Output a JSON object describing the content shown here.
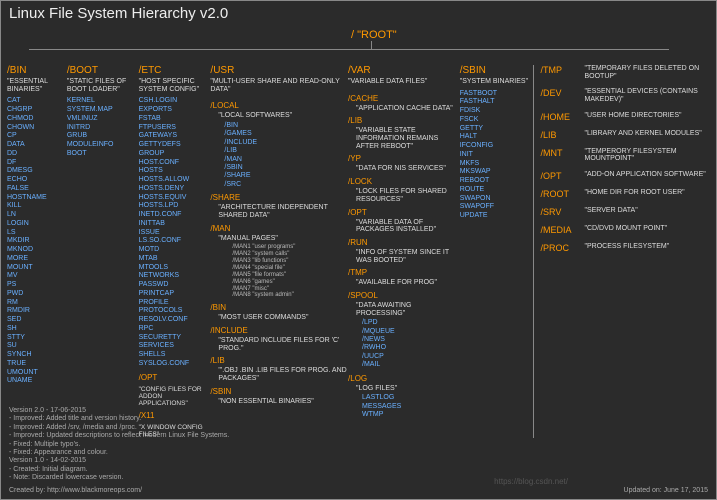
{
  "title": "Linux File System Hierarchy v2.0",
  "root": "/ \"ROOT\"",
  "cols": {
    "bin": {
      "head": "/BIN",
      "desc": "\"ESSENTIAL BINARIES\"",
      "items": [
        "CAT",
        "CHGRP",
        "CHMOD",
        "CHOWN",
        "CP",
        "DATA",
        "DD",
        "DF",
        "DMESG",
        "ECHO",
        "FALSE",
        "HOSTNAME",
        "KILL",
        "LN",
        "LOGIN",
        "LS",
        "MKDIR",
        "MKNOD",
        "MORE",
        "MOUNT",
        "MV",
        "PS",
        "PWD",
        "RM",
        "RMDIR",
        "SED",
        "SH",
        "STTY",
        "SU",
        "SYNCH",
        "TRUE",
        "UMOUNT",
        "UNAME"
      ]
    },
    "boot": {
      "head": "/BOOT",
      "desc": "\"STATIC FILES OF BOOT LOADER\"",
      "items": [
        "KERNEL",
        "SYSTEM.MAP",
        "VMLINUZ",
        "INITRD",
        "GRUB",
        "MODULEINFO",
        "BOOT"
      ]
    },
    "etc": {
      "head": "/ETC",
      "desc": "\"HOST SPECIFIC SYSTEM CONFIG\"",
      "items": [
        "CSH.LOGIN",
        "EXPORTS",
        "FSTAB",
        "FTPUSERS",
        "GATEWAYS",
        "GETTYDEFS",
        "GROUP",
        "HOST.CONF",
        "HOSTS",
        "HOSTS.ALLOW",
        "HOSTS.DENY",
        "HOSTS.EQUIV",
        "HOSTS.LPD",
        "INETD.CONF",
        "INITTAB",
        "ISSUE",
        "LS.SO.CONF",
        "MOTD",
        "MTAB",
        "MTOOLS",
        "NETWORKS",
        "PASSWD",
        "PRINTCAP",
        "PROFILE",
        "PROTOCOLS",
        "RESOLV.CONF",
        "RPC",
        "SECURETTY",
        "SERVICES",
        "SHELLS",
        "SYSLOG.CONF"
      ],
      "opt": {
        "head": "/OPT",
        "desc": "\"CONFIG FILES FOR ADDON APPLICATIONS\""
      },
      "x11": {
        "head": "/X11",
        "desc": "\"X WINDOW CONFIG FILES\""
      }
    },
    "usr": {
      "head": "/USR",
      "desc": "\"MULTI-USER SHARE AND READ-ONLY DATA\"",
      "subs": [
        {
          "head": "/LOCAL",
          "desc": "\"LOCAL SOFTWARES\"",
          "items": [
            "/BIN",
            "/GAMES",
            "/INCLUDE",
            "/LIB",
            "/MAN",
            "/SBIN",
            "/SHARE",
            "/SRC"
          ]
        },
        {
          "head": "/SHARE",
          "desc": "\"ARCHITECTURE INDEPENDENT SHARED DATA\""
        },
        {
          "head": "/MAN",
          "desc": "\"MANUAL PAGES\"",
          "subsubs": [
            "/MAN1 \"user programs\"",
            "/MAN2 \"system calls\"",
            "/MAN3 \"lib functions\"",
            "/MAN4 \"special file\"",
            "/MAN5 \"file formats\"",
            "/MAN6 \"games\"",
            "/MAN7 \"misc\"",
            "/MAN8 \"system admin\""
          ]
        },
        {
          "head": "/BIN",
          "desc": "\"MOST USER COMMANDS\""
        },
        {
          "head": "/INCLUDE",
          "desc": "\"STANDARD INCLUDE FILES FOR 'C' PROG.\""
        },
        {
          "head": "/LIB",
          "desc": "\"'.OBJ .BIN .LIB FILES FOR PROG. AND PACKAGES\""
        },
        {
          "head": "/SBIN",
          "desc": "\"NON ESSENTIAL BINARIES\""
        }
      ]
    },
    "var": {
      "head": "/VAR",
      "desc": "\"VARIABLE DATA FILES\"",
      "subs": [
        {
          "head": "/CACHE",
          "desc": "\"APPLICATION CACHE DATA\""
        },
        {
          "head": "/LIB",
          "desc": "\"VARIABLE STATE INFORMATION REMAINS AFTER REBOOT\""
        },
        {
          "head": "/YP",
          "desc": "\"DATA FOR NIS SERVICES\""
        },
        {
          "head": "/LOCK",
          "desc": "\"LOCK FILES FOR SHARED RESOURCES\""
        },
        {
          "head": "/OPT",
          "desc": "\"VARIABLE DATA OF PACKAGES INSTALLED\""
        },
        {
          "head": "/RUN",
          "desc": "\"INFO OF SYSTEM SINCE IT WAS BOOTED\""
        },
        {
          "head": "/TMP",
          "desc": "\"AVAILABLE FOR PROG\""
        },
        {
          "head": "/SPOOL",
          "desc": "\"DATA AWAITING PROCESSING\"",
          "items": [
            "/LPD",
            "/MQUEUE",
            "/NEWS",
            "/RWHO",
            "/UUCP",
            "/MAIL"
          ]
        },
        {
          "head": "/LOG",
          "desc": "\"LOG FILES\"",
          "items2": [
            "LASTLOG",
            "MESSAGES",
            "WTMP"
          ]
        }
      ]
    },
    "sbin": {
      "head": "/SBIN",
      "desc": "\"SYSTEM BINARIES\"",
      "items": [
        "FASTBOOT",
        "FASTHALT",
        "FDISK",
        "FSCK",
        "GETTY",
        "HALT",
        "IFCONFIG",
        "INIT",
        "MKFS",
        "MKSWAP",
        "REBOOT",
        "ROUTE",
        "SWAPON",
        "SWAPOFF",
        "UPDATE"
      ]
    }
  },
  "right": [
    {
      "head": "/TMP",
      "desc": "\"TEMPORARY FILES DELETED ON BOOTUP\""
    },
    {
      "head": "/DEV",
      "desc": "\"ESSENTIAL DEVICES (CONTAINS MAKEDEV)\""
    },
    {
      "head": "/HOME",
      "desc": "\"USER HOME DIRECTORIES\""
    },
    {
      "head": "/LIB",
      "desc": "\"LIBRARY AND KERNEL MODULES\""
    },
    {
      "head": "/MNT",
      "desc": "\"TEMPERORY FILESYSTEM MOUNTPOINT\""
    },
    {
      "head": "/OPT",
      "desc": "\"ADD-ON APPLICATION SOFTWARE\""
    },
    {
      "head": "/ROOT",
      "desc": "\"HOME DIR FOR ROOT USER\""
    },
    {
      "head": "/SRV",
      "desc": "\"SERVER DATA\""
    },
    {
      "head": "/MEDIA",
      "desc": "\"CD/DVD MOUNT POINT\""
    },
    {
      "head": "/PROC",
      "desc": "\"PROCESS FILESYSTEM\""
    }
  ],
  "footer": {
    "version": [
      "Version 2.0 - 17-06-2015",
      "- Improved: Added title and version history.",
      "- Improved: Added /srv, /media and /proc.",
      "- Improved: Updated descriptions to reflect modern Linux File Systems.",
      "- Fixed: Multiple typo's.",
      "- Fixed: Appearance and colour.",
      "Version 1.0 - 14-02-2015",
      "- Created: Initial diagram.",
      "- Note: Discarded lowercase version."
    ],
    "credit": "Created by: http://www.blackmoreops.com/",
    "updated": "Updated on: June 17, 2015",
    "watermark": "https://blog.csdn.net/"
  }
}
